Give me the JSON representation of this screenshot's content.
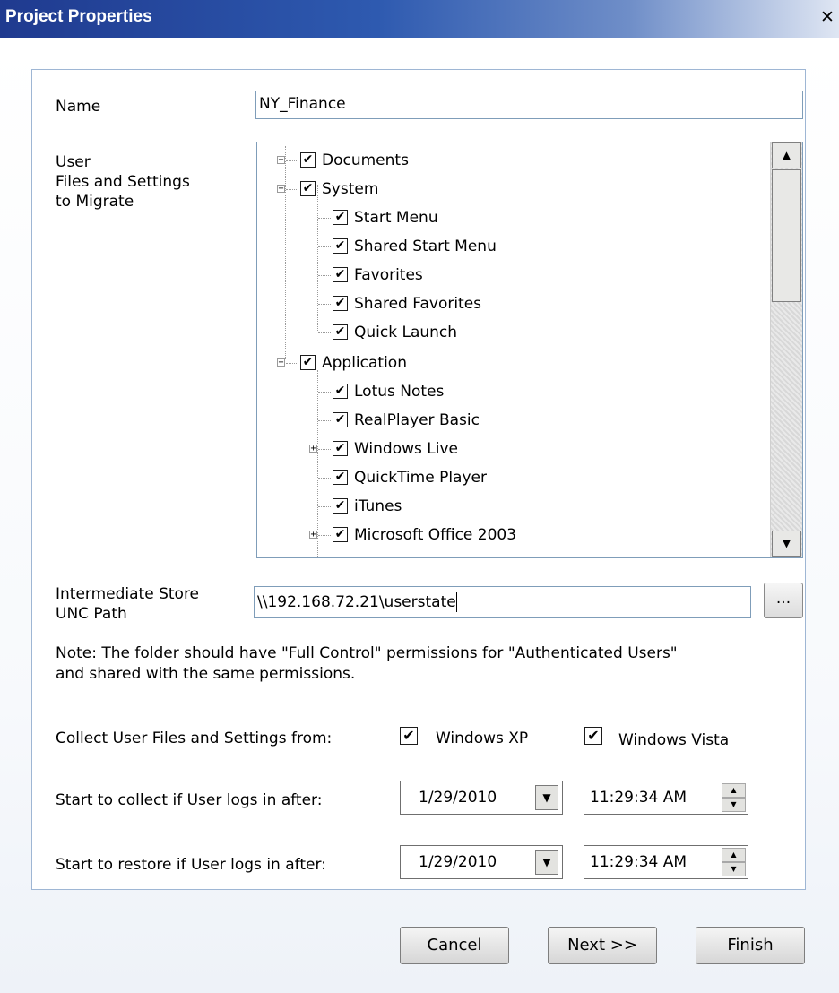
{
  "window": {
    "title": "Project Properties",
    "close_glyph": "✕"
  },
  "form": {
    "name_label": "Name",
    "name_value": "NY_Finance",
    "migrate_label_1": "User",
    "migrate_label_2": "Files and Settings",
    "migrate_label_3": "to Migrate",
    "store_label_1": "Intermediate Store",
    "store_label_2": "UNC Path",
    "store_value": "\\\\192.168.72.21\\userstate",
    "browse_label": "...",
    "note_line_1": "Note: The folder should have \"Full Control\" permissions for \"Authenticated Users\"",
    "note_line_2": "and shared with the same permissions.",
    "collect_label": "Collect User Files and Settings from:",
    "os_xp": "Windows XP",
    "os_vista": "Windows Vista",
    "collect_after_label": "Start to collect if User logs in after:",
    "collect_date": "1/29/2010",
    "collect_time": "11:29:34 AM",
    "restore_after_label": "Start to restore if User logs in after:",
    "restore_date": "1/29/2010",
    "restore_time": "11:29:34 AM"
  },
  "tree": {
    "items": [
      {
        "label": "Documents",
        "checked": true
      },
      {
        "label": "System",
        "checked": true
      },
      {
        "label": "Start Menu",
        "checked": true
      },
      {
        "label": "Shared Start Menu",
        "checked": true
      },
      {
        "label": "Favorites",
        "checked": true
      },
      {
        "label": "Shared Favorites",
        "checked": true
      },
      {
        "label": "Quick Launch",
        "checked": true
      },
      {
        "label": "Application",
        "checked": true
      },
      {
        "label": "Lotus Notes",
        "checked": true
      },
      {
        "label": "RealPlayer Basic",
        "checked": true
      },
      {
        "label": "Windows Live",
        "checked": true
      },
      {
        "label": "QuickTime Player",
        "checked": true
      },
      {
        "label": "iTunes",
        "checked": true
      },
      {
        "label": "Microsoft Office 2003",
        "checked": true
      }
    ],
    "check_glyph": "✔",
    "expand_plus": "+",
    "expand_minus": "−",
    "scroll_up_glyph": "▲",
    "scroll_down_glyph": "▼"
  },
  "dropdown_glyph": "▼",
  "spin_up_glyph": "▲",
  "spin_down_glyph": "▼",
  "buttons": {
    "cancel": "Cancel",
    "next": "Next >>",
    "finish": "Finish"
  },
  "colors": {
    "title_bar": "#1f3a8f",
    "panel_border": "#9eb6d4",
    "input_border": "#7f9db9"
  }
}
